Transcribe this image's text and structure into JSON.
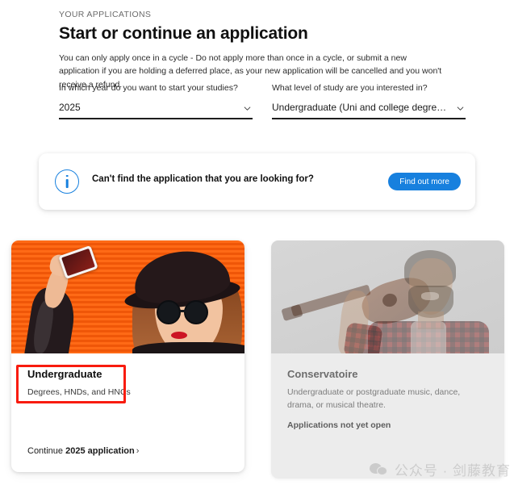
{
  "header": {
    "eyebrow": "YOUR APPLICATIONS",
    "title": "Start or continue an application",
    "description": "You can only apply once in a cycle - Do not apply more than once in a cycle, or submit a new application if you are holding a deferred place, as your new application will be cancelled and you won't receive a refund."
  },
  "form": {
    "year_field": {
      "label": "In which year do you want to start your studies?",
      "value": "2025"
    },
    "level_field": {
      "label": "What level of study are you interested in?",
      "value": "Undergraduate (Uni and college degrees, and ap…"
    }
  },
  "info_banner": {
    "icon": "info-circle-icon",
    "message": "Can't find the application that you are looking for?",
    "button_label": "Find out more",
    "button_color": "#1780de"
  },
  "cards": [
    {
      "id": "undergraduate",
      "title": "Undergraduate",
      "subtitle": "Degrees, HNDs, and HNCs",
      "link_prefix": "Continue ",
      "link_strong": "2025 application",
      "link_arrow": "›",
      "image_alt": "woman-taking-selfie-photo",
      "enabled": true
    },
    {
      "id": "conservatoire",
      "title": "Conservatoire",
      "subtitle": "Undergraduate or postgraduate music, dance, drama, or musical theatre.",
      "status": "Applications not yet open",
      "image_alt": "man-holding-guitar-photo",
      "enabled": false
    }
  ],
  "annotation": {
    "color": "#f81b0e",
    "target": "undergraduate-card-title"
  },
  "watermark": {
    "text": "公众号 · 剑藤教育",
    "logo": "wechat-icon"
  }
}
